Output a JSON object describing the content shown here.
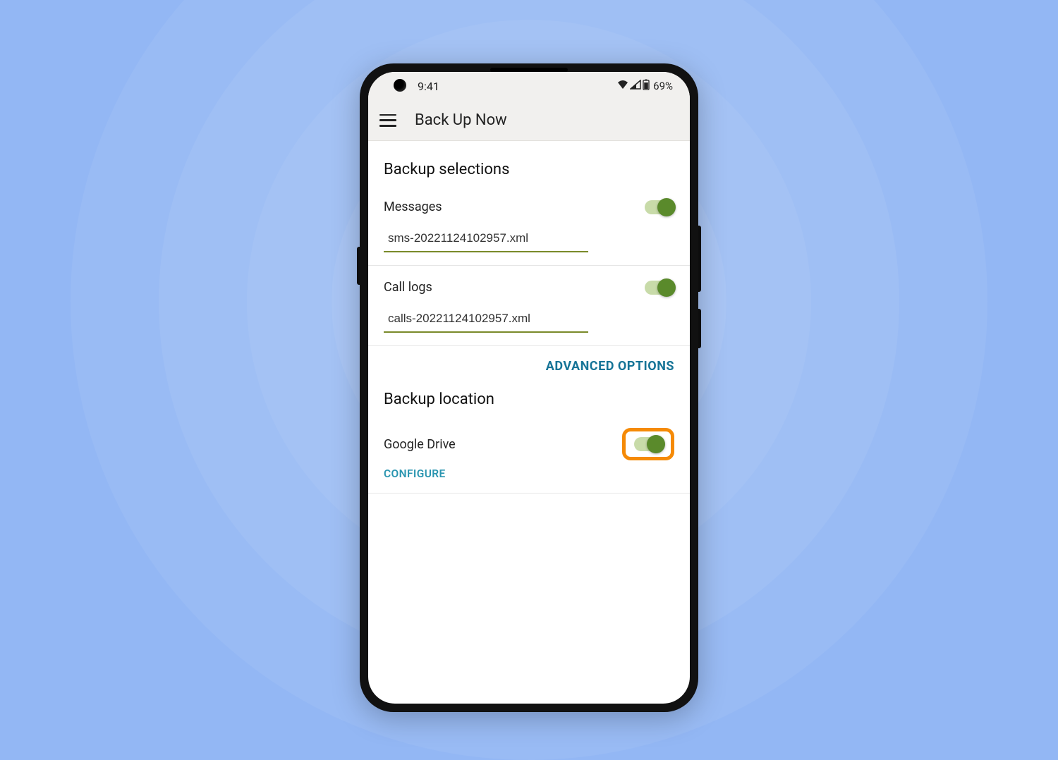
{
  "status": {
    "time": "9:41",
    "battery": "69%",
    "icons": {
      "wifi": "wifi-icon",
      "signal": "signal-icon",
      "battery": "battery-icon"
    }
  },
  "appbar": {
    "title": "Back Up Now",
    "menu_icon": "hamburger-icon"
  },
  "sections": {
    "selections": {
      "title": "Backup selections",
      "messages": {
        "label": "Messages",
        "enabled": true,
        "filename": "sms-20221124102957.xml"
      },
      "call_logs": {
        "label": "Call logs",
        "enabled": true,
        "filename": "calls-20221124102957.xml"
      },
      "advanced_label": "ADVANCED OPTIONS"
    },
    "location": {
      "title": "Backup location",
      "google_drive": {
        "label": "Google Drive",
        "enabled": true,
        "highlighted": true
      },
      "configure_label": "CONFIGURE"
    }
  },
  "colors": {
    "accent_teal": "#167497",
    "toggle_on": "#5a8a2b",
    "highlight": "#f58a07"
  }
}
